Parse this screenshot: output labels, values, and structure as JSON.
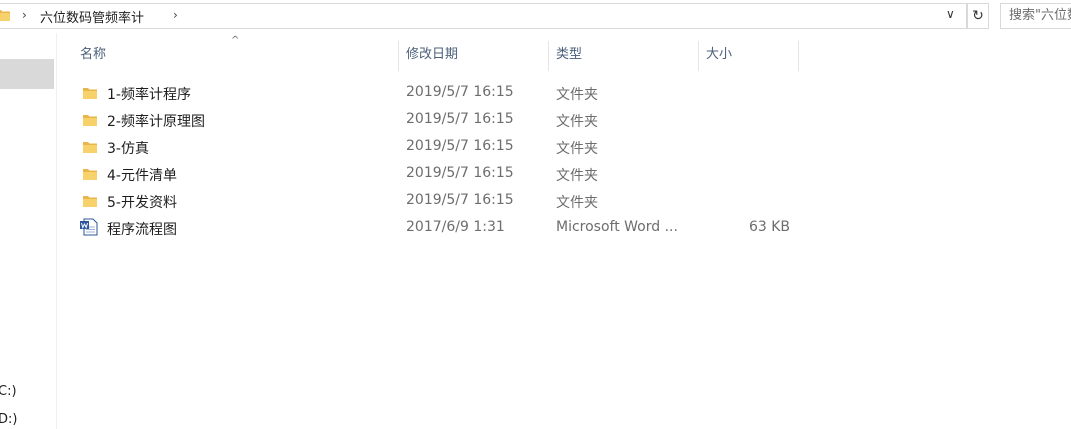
{
  "address": {
    "breadcrumb": "六位数码管频率计",
    "search_placeholder": "搜索\"六位数码管频率计\""
  },
  "nav": {
    "drives": [
      "C:)",
      "D:)"
    ]
  },
  "columns": {
    "name": "名称",
    "date": "修改日期",
    "type": "类型",
    "size": "大小"
  },
  "files": [
    {
      "name": "1-频率计程序",
      "date": "2019/5/7 16:15",
      "type": "文件夹",
      "size": "",
      "icon": "folder-icon"
    },
    {
      "name": "2-频率计原理图",
      "date": "2019/5/7 16:15",
      "type": "文件夹",
      "size": "",
      "icon": "folder-icon"
    },
    {
      "name": "3-仿真",
      "date": "2019/5/7 16:15",
      "type": "文件夹",
      "size": "",
      "icon": "folder-icon"
    },
    {
      "name": "4-元件清单",
      "date": "2019/5/7 16:15",
      "type": "文件夹",
      "size": "",
      "icon": "folder-icon"
    },
    {
      "name": "5-开发资料",
      "date": "2019/5/7 16:15",
      "type": "文件夹",
      "size": "",
      "icon": "folder-icon"
    },
    {
      "name": "程序流程图",
      "date": "2017/6/9 1:31",
      "type": "Microsoft Word ...",
      "size": "63 KB",
      "icon": "word-doc-icon"
    }
  ]
}
